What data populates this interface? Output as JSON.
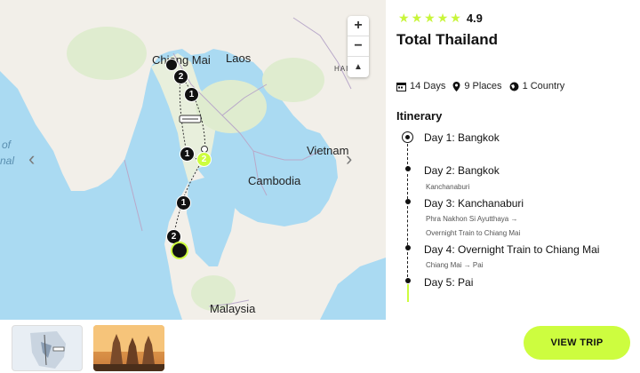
{
  "map": {
    "labels": {
      "chiang_mai": "Chiang Mai",
      "laos": "Laos",
      "hai": "HAI",
      "vietnam": "Vietnam",
      "cambodia": "Cambodia",
      "malaysia": "Malaysia",
      "sea_of": "of",
      "sea_nal": "nal"
    },
    "zoom_in": "+",
    "zoom_out": "−",
    "compass": "▲",
    "prev": "‹",
    "next": "›",
    "markers": [
      "2",
      "1",
      "1",
      "2",
      "1",
      "2"
    ]
  },
  "trip": {
    "rating": "4.9",
    "title": "Total Thailand",
    "days": "14 Days",
    "places": "9 Places",
    "countries": "1 Country"
  },
  "itinerary": {
    "heading": "Itinerary",
    "days": [
      {
        "title": "Day 1: Bangkok",
        "sub": ""
      },
      {
        "title": "Day 2: Bangkok",
        "sub": "Kanchanaburi"
      },
      {
        "title": "Day 3: Kanchanaburi",
        "sub": "Phra Nakhon Si Ayutthaya →",
        "sub2": "Overnight Train to Chiang Mai"
      },
      {
        "title": "Day 4: Overnight Train to Chiang Mai",
        "sub": "Chiang Mai → Pai"
      },
      {
        "title": "Day 5: Pai",
        "sub": ""
      }
    ]
  },
  "cta": {
    "label": "VIEW TRIP"
  },
  "colors": {
    "accent": "#cdfd3f",
    "water": "#aadaf2",
    "land": "#f2efe9"
  }
}
